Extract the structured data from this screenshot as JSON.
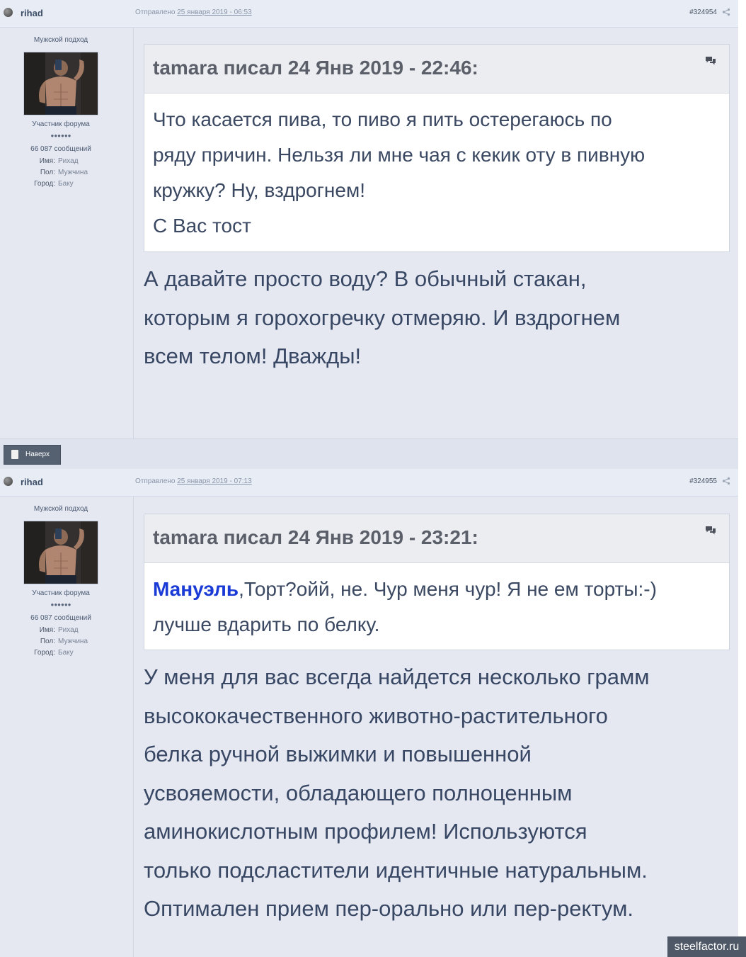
{
  "posts": [
    {
      "author": "rihad",
      "posted_prefix": "Отправлено",
      "posted_date": "25 января 2019 - 06:53",
      "post_number": "#324954",
      "sidebar": {
        "title": "Мужской подход",
        "rank": "Участник форума",
        "pips": "●●●●●●",
        "posts_count": "66 087 сообщений",
        "fields": [
          {
            "key": "Имя:",
            "value": "Рихад"
          },
          {
            "key": "Пол:",
            "value": "Мужчина"
          },
          {
            "key": "Город:",
            "value": "Баку"
          }
        ]
      },
      "quote": {
        "title": "tamara писал 24 Янв 2019 - 22:46:",
        "lines": [
          "Что касается пива, то пиво я пить остерегаюсь по",
          "ряду причин. Нельзя ли мне чая с кекик оту в пивную",
          "кружку? Ну, вздрогнем!",
          "С Вас тост"
        ]
      },
      "reply_lines": [
        "А давайте просто воду? В обычный стакан,",
        "которым я горохогречку отмеряю. И вздрогнем",
        "всем телом! Дважды!"
      ]
    },
    {
      "author": "rihad",
      "posted_prefix": "Отправлено",
      "posted_date": "25 января 2019 - 07:13",
      "post_number": "#324955",
      "sidebar": {
        "title": "Мужской подход",
        "rank": "Участник форума",
        "pips": "●●●●●●",
        "posts_count": "66 087 сообщений",
        "fields": [
          {
            "key": "Имя:",
            "value": "Рихад"
          },
          {
            "key": "Пол:",
            "value": "Мужчина"
          },
          {
            "key": "Город:",
            "value": "Баку"
          }
        ]
      },
      "quote": {
        "title": "tamara писал 24 Янв 2019 - 23:21:",
        "mention": "Мануэль",
        "line1_rest": ",Торт?ойй, не. Чур меня чур! Я не ем торты:-)",
        "line2": "лучше вдарить по белку."
      },
      "reply_lines": [
        "У меня для вас всегда найдется несколько грамм",
        "высококачественного животно-растительного",
        "белка ручной выжимки и повышенной",
        "усвояемости, обладающего полноценным",
        "аминокислотным профилем! Используются",
        "только подсластители идентичные натуральным.",
        "Оптимален прием пер-орально или пер-ректум."
      ]
    }
  ],
  "back_to_top": "Наверх",
  "watermark": "steelfactor.ru",
  "colors": {
    "mention": "#1a3bd6",
    "text": "#384763",
    "post_bg": "#e5e8f1"
  }
}
